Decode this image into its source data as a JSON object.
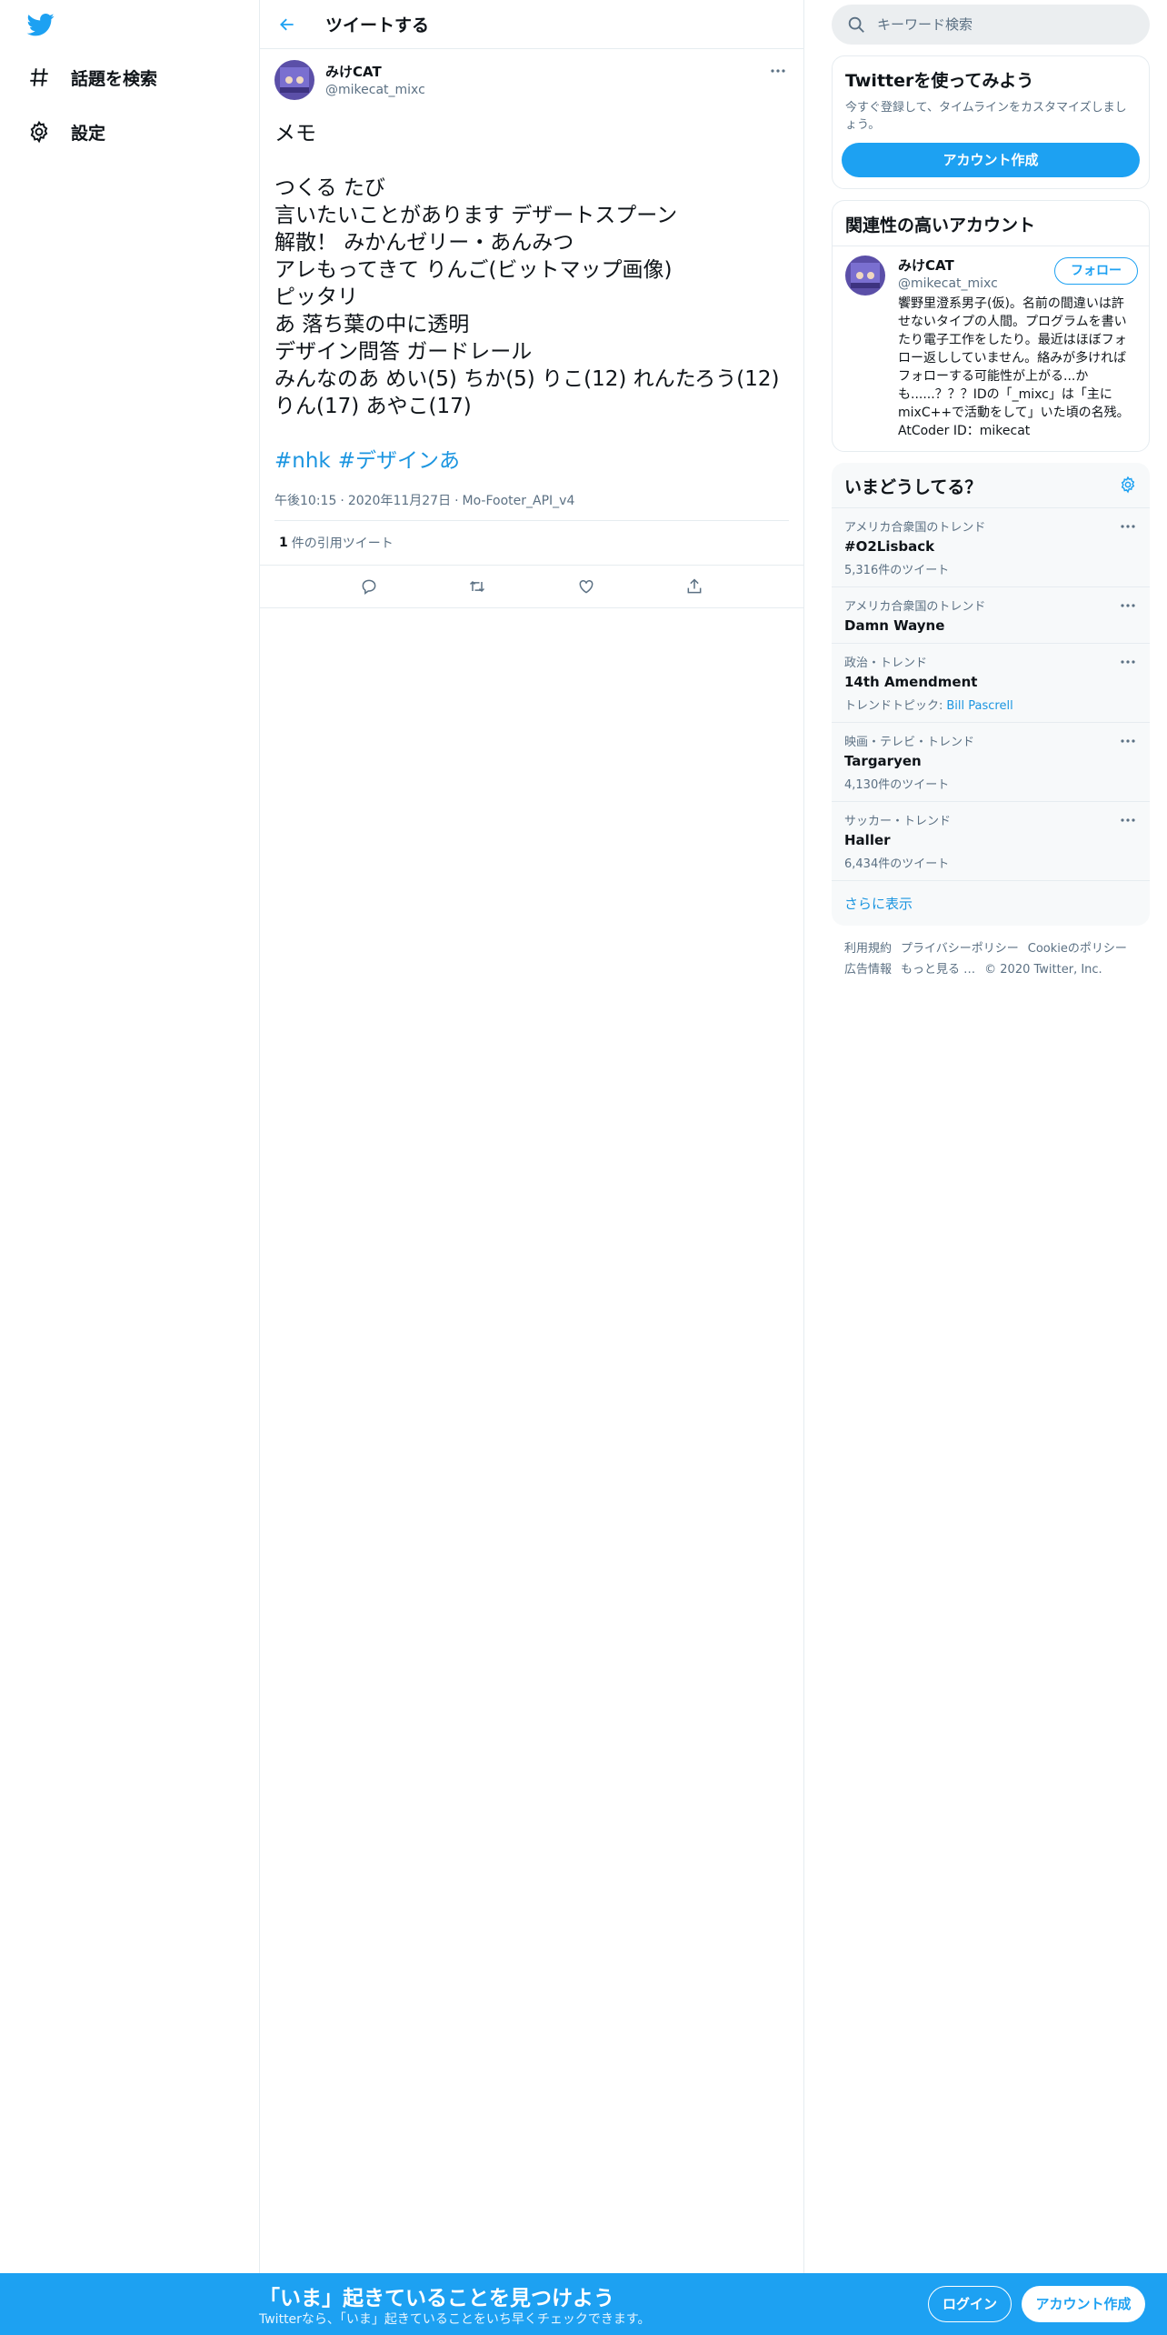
{
  "nav": {
    "logo_icon": "twitter-bird-icon",
    "items": [
      {
        "label": "話題を検索",
        "icon": "hashtag-icon"
      },
      {
        "label": "設定",
        "icon": "gear-icon"
      }
    ]
  },
  "header": {
    "title": "ツイートする"
  },
  "tweet": {
    "author_name": "みけCAT",
    "author_handle": "@mikecat_mixc",
    "lines": [
      "メモ",
      "",
      "つくる たび",
      "言いたいことがあります デザートスプーン",
      "解散！ みかんゼリー・あんみつ",
      "アレもってきて りんご(ビットマップ画像)",
      "ピッタリ",
      "あ 落ち葉の中に透明",
      "デザイン問答 ガードレール",
      "みんなのあ めい(5) ちか(5) りこ(12) れんたろう(12)",
      "りん(17) あやこ(17)"
    ],
    "hashtags": [
      "#nhk",
      "#デザインあ"
    ],
    "time": "午後10:15",
    "date": "2020年11月27日",
    "source": "Mo-Footer_API_v4",
    "quote_count": "1",
    "quote_label": "件の引用ツイート"
  },
  "search": {
    "placeholder": "キーワード検索"
  },
  "signup_card": {
    "title": "Twitterを使ってみよう",
    "subtitle": "今すぐ登録して、タイムラインをカスタマイズしましょう。",
    "button": "アカウント作成"
  },
  "related": {
    "title": "関連性の高いアカウント",
    "name": "みけCAT",
    "handle": "@mikecat_mixc",
    "follow": "フォロー",
    "bio": "饗野里澄系男子(仮)。名前の間違いは許せないタイプの人間。プログラムを書いたり電子工作をしたり。最近はほぼフォロー返ししていません。絡みが多ければフォローする可能性が上がる...かも......？？？IDの「_mixc」は「主にmixC++で活動をして」いた頃の名残。AtCoder ID：mikecat"
  },
  "trends": {
    "title": "いまどうしてる？",
    "items": [
      {
        "context": "アメリカ合衆国のトレンド",
        "name": "#O2Lisback",
        "count": "5,316件のツイート"
      },
      {
        "context": "アメリカ合衆国のトレンド",
        "name": "Damn Wayne",
        "count": ""
      },
      {
        "context": "政治・トレンド",
        "name": "14th Amendment",
        "topic_label": "トレンドトピック:",
        "topic": "Bill Pascrell"
      },
      {
        "context": "映画・テレビ・トレンド",
        "name": "Targaryen",
        "count": "4,130件のツイート"
      },
      {
        "context": "サッカー・トレンド",
        "name": "Haller",
        "count": "6,434件のツイート"
      }
    ],
    "show_more": "さらに表示"
  },
  "footer": {
    "links": [
      "利用規約",
      "プライバシーポリシー",
      "Cookieのポリシー",
      "広告情報",
      "もっと見る …",
      "© 2020 Twitter, Inc."
    ]
  },
  "bottom_bar": {
    "title": "「いま」起きていることを見つけよう",
    "subtitle": "Twitterなら、「いま」起きていることをいち早くチェックできます。",
    "login": "ログイン",
    "signup": "アカウント作成"
  },
  "colors": {
    "brand": "#1da1f2",
    "link": "#1b95e0",
    "muted": "#5b7083"
  }
}
